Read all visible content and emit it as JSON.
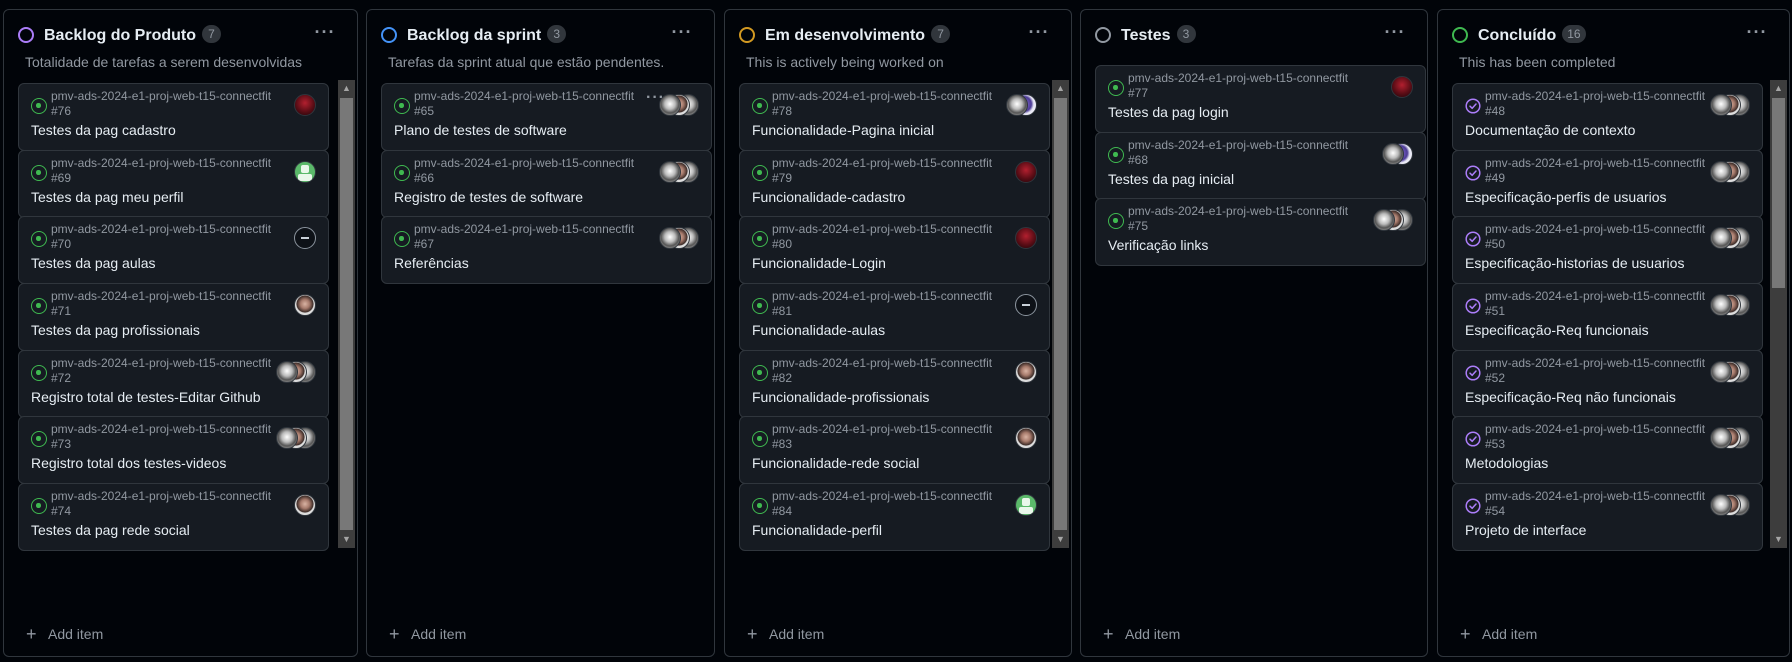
{
  "add_item_label": "Add item",
  "more_glyph": "···",
  "colors": {
    "background": "#010409",
    "card": "#161b22",
    "border": "#30363d",
    "muted": "#9198a1",
    "open_issue": "#3fb950",
    "closed_issue": "#ab7df8"
  },
  "columns": [
    {
      "title": "Backlog do Produto",
      "count": "7",
      "description": "Totalidade de tarefas a serem desenvolvidas",
      "status_color": "#ab7df8",
      "status": "purple-circle-icon",
      "cards": [
        {
          "repo": "pmv-ads-2024-e1-proj-web-t15-connectfit #76",
          "title": "Testes da pag cadastro",
          "avatars": [
            "red"
          ]
        },
        {
          "repo": "pmv-ads-2024-e1-proj-web-t15-connectfit #69",
          "title": "Testes da pag meu perfil",
          "avatars": [
            "green"
          ]
        },
        {
          "repo": "pmv-ads-2024-e1-proj-web-t15-connectfit #70",
          "title": "Testes da pag aulas",
          "avatars": [
            "dark"
          ]
        },
        {
          "repo": "pmv-ads-2024-e1-proj-web-t15-connectfit #71",
          "title": "Testes da pag profissionais",
          "avatars": [
            "face"
          ]
        },
        {
          "repo": "pmv-ads-2024-e1-proj-web-t15-connectfit #72",
          "title": "Registro total de testes-Editar Github",
          "avatars": [
            "gray",
            "face",
            "gray"
          ]
        },
        {
          "repo": "pmv-ads-2024-e1-proj-web-t15-connectfit #73",
          "title": "Registro total dos testes-videos",
          "avatars": [
            "gray",
            "face",
            "gray"
          ]
        },
        {
          "repo": "pmv-ads-2024-e1-proj-web-t15-connectfit #74",
          "title": "Testes da pag rede social",
          "avatars": [
            "face"
          ]
        }
      ]
    },
    {
      "title": "Backlog da sprint",
      "count": "3",
      "description": "Tarefas da sprint atual que estão pendentes.",
      "status_color": "#4493f8",
      "status": "blue-circle-icon",
      "cards": [
        {
          "repo": "pmv-ads-2024-e1-proj-web-t15-connectfit #65",
          "title": "Plano de testes de software",
          "avatars": [
            "gray",
            "face",
            "gray"
          ],
          "hover_menu": true
        },
        {
          "repo": "pmv-ads-2024-e1-proj-web-t15-connectfit #66",
          "title": "Registro de testes de software",
          "avatars": [
            "gray",
            "face",
            "gray"
          ]
        },
        {
          "repo": "pmv-ads-2024-e1-proj-web-t15-connectfit #67",
          "title": "Referências",
          "avatars": [
            "gray",
            "face",
            "gray"
          ]
        }
      ]
    },
    {
      "title": "Em desenvolvimento",
      "count": "7",
      "description": "This is actively being worked on",
      "status_color": "#d29922",
      "status": "orange-circle-icon",
      "cards": [
        {
          "repo": "pmv-ads-2024-e1-proj-web-t15-connectfit #78",
          "title": "Funcionalidade-Pagina inicial",
          "avatars": [
            "purple",
            "gray"
          ]
        },
        {
          "repo": "pmv-ads-2024-e1-proj-web-t15-connectfit #79",
          "title": "Funcionalidade-cadastro",
          "avatars": [
            "red"
          ]
        },
        {
          "repo": "pmv-ads-2024-e1-proj-web-t15-connectfit #80",
          "title": "Funcionalidade-Login",
          "avatars": [
            "red"
          ]
        },
        {
          "repo": "pmv-ads-2024-e1-proj-web-t15-connectfit #81",
          "title": "Funcionalidade-aulas",
          "avatars": [
            "dark"
          ]
        },
        {
          "repo": "pmv-ads-2024-e1-proj-web-t15-connectfit #82",
          "title": "Funcionalidade-profissionais",
          "avatars": [
            "face"
          ]
        },
        {
          "repo": "pmv-ads-2024-e1-proj-web-t15-connectfit #83",
          "title": "Funcionalidade-rede social",
          "avatars": [
            "face"
          ]
        },
        {
          "repo": "pmv-ads-2024-e1-proj-web-t15-connectfit #84",
          "title": "Funcionalidade-perfil",
          "avatars": [
            "green"
          ]
        }
      ]
    },
    {
      "title": "Testes",
      "count": "3",
      "description": "",
      "status_color": "#9198a1",
      "status": "gray-circle-icon",
      "cards": [
        {
          "repo": "pmv-ads-2024-e1-proj-web-t15-connectfit #77",
          "title": "Testes da pag login",
          "avatars": [
            "red"
          ]
        },
        {
          "repo": "pmv-ads-2024-e1-proj-web-t15-connectfit #68",
          "title": "Testes da pag inicial",
          "avatars": [
            "purple",
            "gray"
          ]
        },
        {
          "repo": "pmv-ads-2024-e1-proj-web-t15-connectfit #75",
          "title": "Verificação links",
          "avatars": [
            "gray",
            "face",
            "gray"
          ]
        }
      ]
    },
    {
      "title": "Concluído",
      "count": "16",
      "description": "This has been completed",
      "status_color": "#3fb950",
      "status": "green-circle-icon",
      "closed": true,
      "cards": [
        {
          "repo": "pmv-ads-2024-e1-proj-web-t15-connectfit #48",
          "title": "Documentação de contexto",
          "avatars": [
            "gray",
            "face",
            "gray"
          ]
        },
        {
          "repo": "pmv-ads-2024-e1-proj-web-t15-connectfit #49",
          "title": "Especificação-perfis de usuarios",
          "avatars": [
            "gray",
            "face",
            "gray"
          ]
        },
        {
          "repo": "pmv-ads-2024-e1-proj-web-t15-connectfit #50",
          "title": "Especificação-historias de usuarios",
          "avatars": [
            "gray",
            "face",
            "gray"
          ]
        },
        {
          "repo": "pmv-ads-2024-e1-proj-web-t15-connectfit #51",
          "title": "Especificação-Req funcionais",
          "avatars": [
            "gray",
            "face",
            "gray"
          ]
        },
        {
          "repo": "pmv-ads-2024-e1-proj-web-t15-connectfit #52",
          "title": "Especificação-Req não funcionais",
          "avatars": [
            "gray",
            "face",
            "gray"
          ]
        },
        {
          "repo": "pmv-ads-2024-e1-proj-web-t15-connectfit #53",
          "title": "Metodologias",
          "avatars": [
            "gray",
            "face",
            "gray"
          ]
        },
        {
          "repo": "pmv-ads-2024-e1-proj-web-t15-connectfit #54",
          "title": "Projeto de interface",
          "avatars": [
            "gray",
            "face",
            "gray"
          ]
        }
      ]
    }
  ]
}
